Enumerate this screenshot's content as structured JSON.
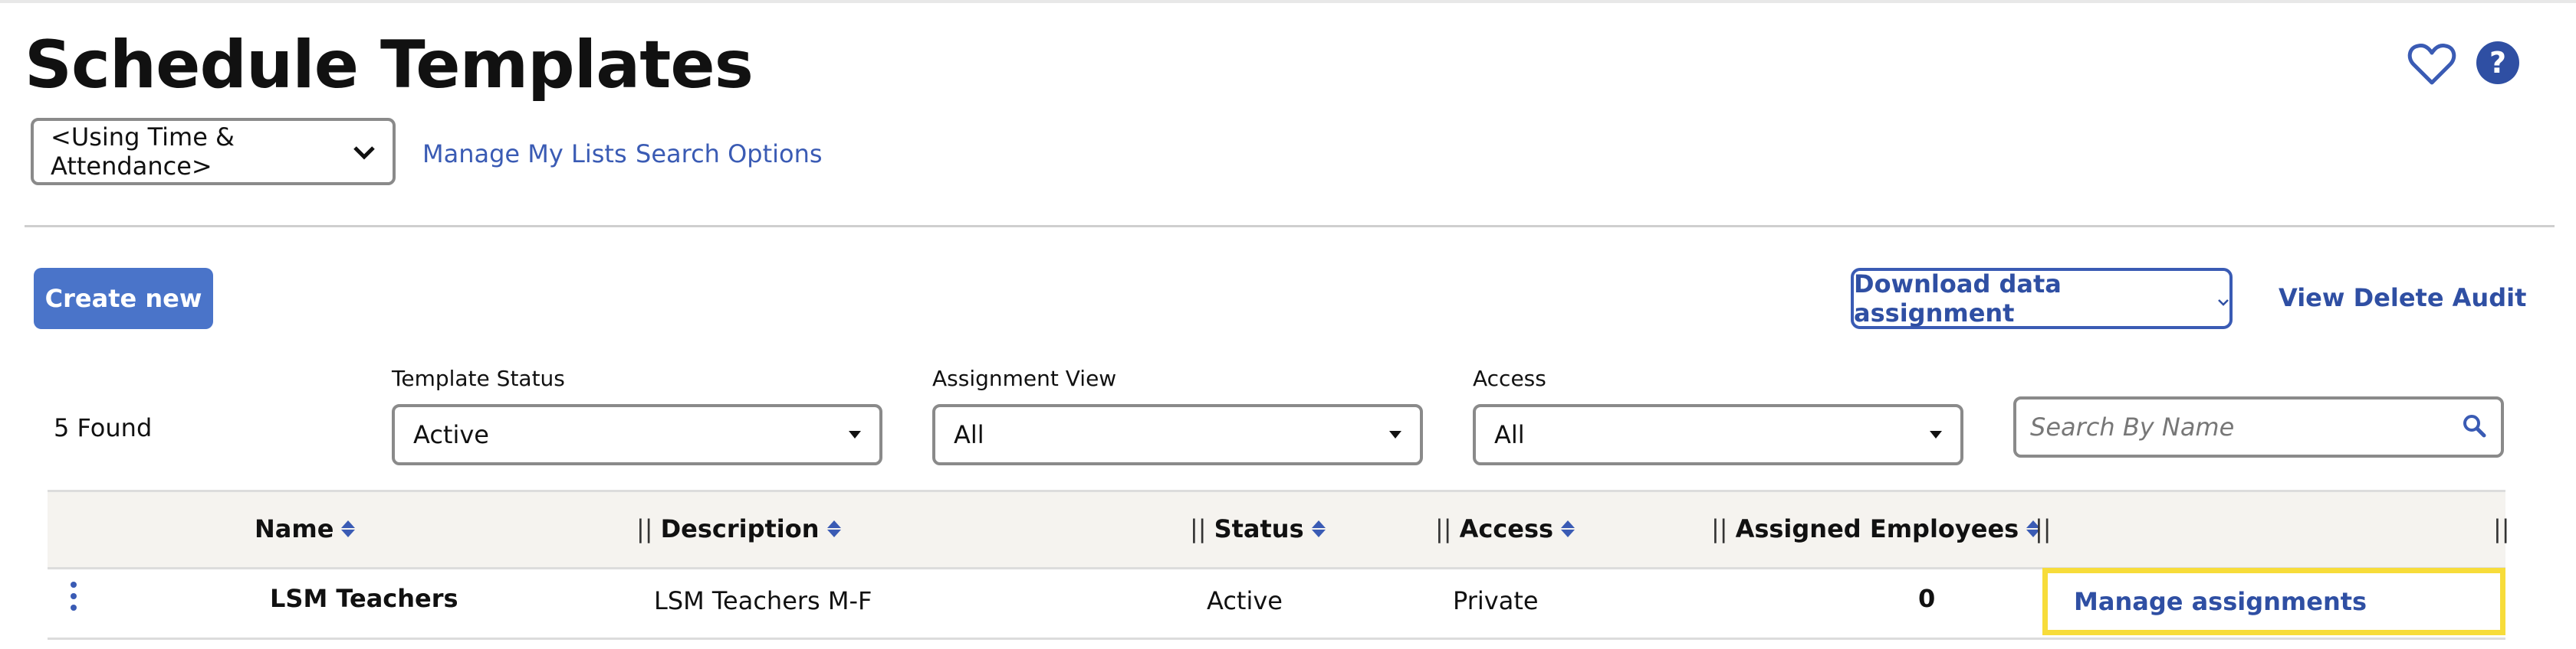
{
  "page": {
    "title": "Schedule Templates"
  },
  "header": {
    "favorite_icon": "heart-icon",
    "help_icon": "help-icon"
  },
  "list_select": {
    "value": "<Using Time & Attendance>"
  },
  "links": {
    "manage_lists": "Manage My Lists",
    "search_options": "Search Options"
  },
  "toolbar": {
    "create_label": "Create new",
    "download_label": "Download data assignment",
    "view_audit_label": "View Delete Audit"
  },
  "results": {
    "found": "5 Found"
  },
  "filters": {
    "template_status": {
      "label": "Template Status",
      "value": "Active"
    },
    "assignment_view": {
      "label": "Assignment View",
      "value": "All"
    },
    "access": {
      "label": "Access",
      "value": "All"
    }
  },
  "search": {
    "placeholder": "Search By Name"
  },
  "table": {
    "columns": {
      "name": "Name",
      "description": "Description",
      "status": "Status",
      "access": "Access",
      "assigned": "Assigned Employees",
      "separator": "||"
    },
    "rows": [
      {
        "name": "LSM Teachers",
        "description": "LSM Teachers M-F",
        "status": "Active",
        "access": "Private",
        "assigned": "0",
        "action": "Manage assignments"
      }
    ]
  },
  "colors": {
    "accent": "#4a74c9",
    "link": "#3a5bb4",
    "highlight": "#f7dc3a"
  }
}
